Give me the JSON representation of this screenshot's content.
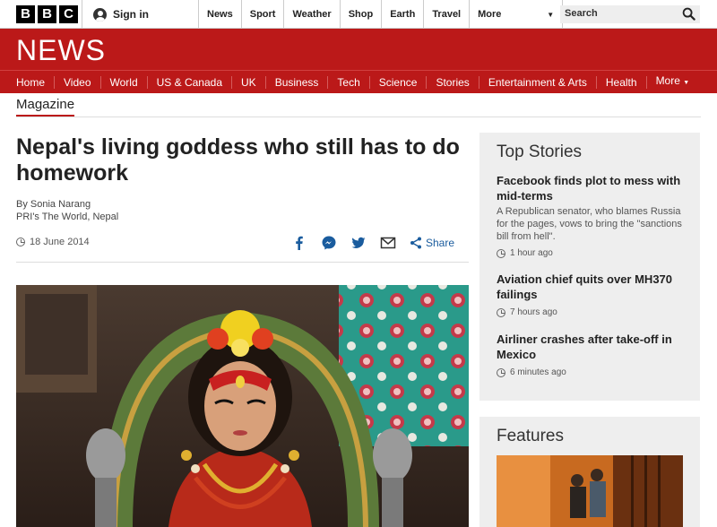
{
  "topbar": {
    "logo_letters": [
      "B",
      "B",
      "C"
    ],
    "signin_label": "Sign in",
    "nav": [
      "News",
      "Sport",
      "Weather",
      "Shop",
      "Earth",
      "Travel"
    ],
    "more_label": "More",
    "search_placeholder": "Search"
  },
  "news_header": {
    "title": "NEWS",
    "nav": [
      "Home",
      "Video",
      "World",
      "US & Canada",
      "UK",
      "Business",
      "Tech",
      "Science",
      "Stories",
      "Entertainment & Arts",
      "Health"
    ],
    "more_label": "More"
  },
  "article": {
    "section": "Magazine",
    "headline": "Nepal's living goddess who still has to do homework",
    "author": "By Sonia Narang",
    "source": "PRI's The World, Nepal",
    "date": "18 June 2014",
    "share_label": "Share",
    "share_icons": [
      "facebook-icon",
      "messenger-icon",
      "twitter-icon",
      "email-icon",
      "share-icon"
    ]
  },
  "top_stories": {
    "title": "Top Stories",
    "items": [
      {
        "title": "Facebook finds plot to mess with mid-terms",
        "summary": "A Republican senator, who blames Russia for the pages, vows to bring the \"sanctions bill from hell\".",
        "time": "1 hour ago"
      },
      {
        "title": "Aviation chief quits over MH370 failings",
        "summary": "",
        "time": "7 hours ago"
      },
      {
        "title": "Airliner crashes after take-off in Mexico",
        "summary": "",
        "time": "6 minutes ago"
      }
    ]
  },
  "features": {
    "title": "Features"
  },
  "colors": {
    "brand_red": "#bb1919",
    "link_blue": "#1a5c9e",
    "panel_grey": "#eeeeee"
  }
}
